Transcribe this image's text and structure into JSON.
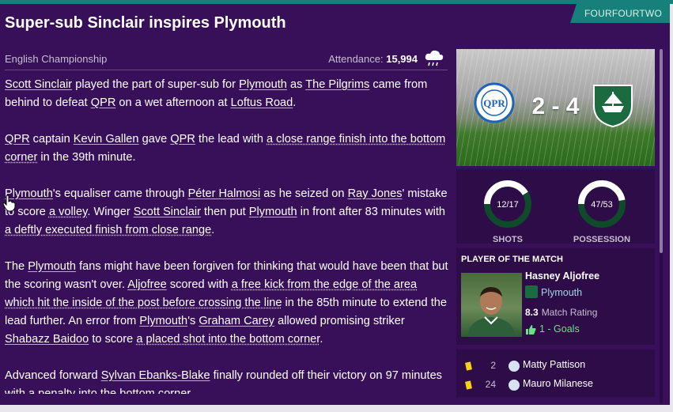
{
  "source": "FOURFOURTWO",
  "headline": "Super-sub Sinclair inspires Plymouth",
  "competition": "English Championship",
  "attendance_label": "Attendance:",
  "attendance_value": "15,994",
  "weather_icon": "rain-cloud-icon",
  "score": "2 - 4",
  "home_crest_icon": "qpr-crest-icon",
  "away_crest_icon": "plymouth-crest-icon",
  "stats": [
    {
      "label": "SHOTS",
      "display": "12/17",
      "home": 12,
      "away": 17
    },
    {
      "label": "POSSESSION",
      "display": "47/53",
      "home": 47,
      "away": 53
    }
  ],
  "potm": {
    "title": "PLAYER OF THE MATCH",
    "name": "Hasney Aljofree",
    "club": "Plymouth",
    "rating_value": "8.3",
    "rating_label": "Match Rating",
    "goals": "1 - Goals"
  },
  "cards": [
    {
      "minute": "2",
      "player": "Matty Pattison"
    },
    {
      "minute": "24",
      "player": "Mauro Milanese"
    }
  ],
  "article": {
    "p1": {
      "a": "Scott Sinclair",
      "b": " played the part of super-sub for ",
      "c": "Plymouth",
      "d": " as ",
      "e": "The Pilgrims",
      "f": " came from behind to defeat ",
      "g": "QPR",
      "h": " on a wet afternoon at ",
      "i": "Loftus Road",
      "j": "."
    },
    "p2": {
      "a": "QPR",
      "b": " captain ",
      "c": "Kevin Gallen",
      "d": " gave ",
      "e": "QPR",
      "f": " the lead with ",
      "g": "a close range finish into the bottom corner",
      "h": " in the 39th minute."
    },
    "p3": {
      "a": "Plymouth",
      "b": "'s equaliser came through ",
      "c": "Péter Halmosi",
      "d": " as he seized on ",
      "e": "Ray Jones",
      "f": "' mistake to score ",
      "g": "a volley",
      "h": ". Winger ",
      "i": "Scott Sinclair",
      "j": " then put ",
      "k": "Plymouth",
      "l": " in front after 83 minutes with ",
      "m": "a deftly executed finish from close range",
      "n": "."
    },
    "p4": {
      "a": "The ",
      "b": "Plymouth",
      "c": " fans might have been forgiven for thinking that would have been that but the scoring wasn't over. ",
      "d": "Aljofree",
      "e": " scored with ",
      "f": "a free kick from the edge of the area which hit the inside of the post before crossing the line",
      "g": " in the 85th minute to extend the lead further. An error from ",
      "h": "Plymouth",
      "i": "'s ",
      "j": "Graham Carey",
      "k": " allowed promising striker ",
      "l": "Shabazz Baidoo",
      "m": " to score ",
      "n": "a placed shot into the bottom corner",
      "o": "."
    },
    "p5": {
      "a": "Advanced forward ",
      "b": "Sylvan Ebanks-Blake",
      "c": " finally rounded off their victory on 97 minutes with ",
      "d": "a penalty into the bottom corner",
      "e": "."
    }
  },
  "colors": {
    "background": "#38105a",
    "accent_teal": "#18807a",
    "card_bg": "#2d0c48",
    "ring_fill": "#ffffff",
    "ring_rest": "#0f4a2a",
    "goals_green": "#6be08c"
  }
}
